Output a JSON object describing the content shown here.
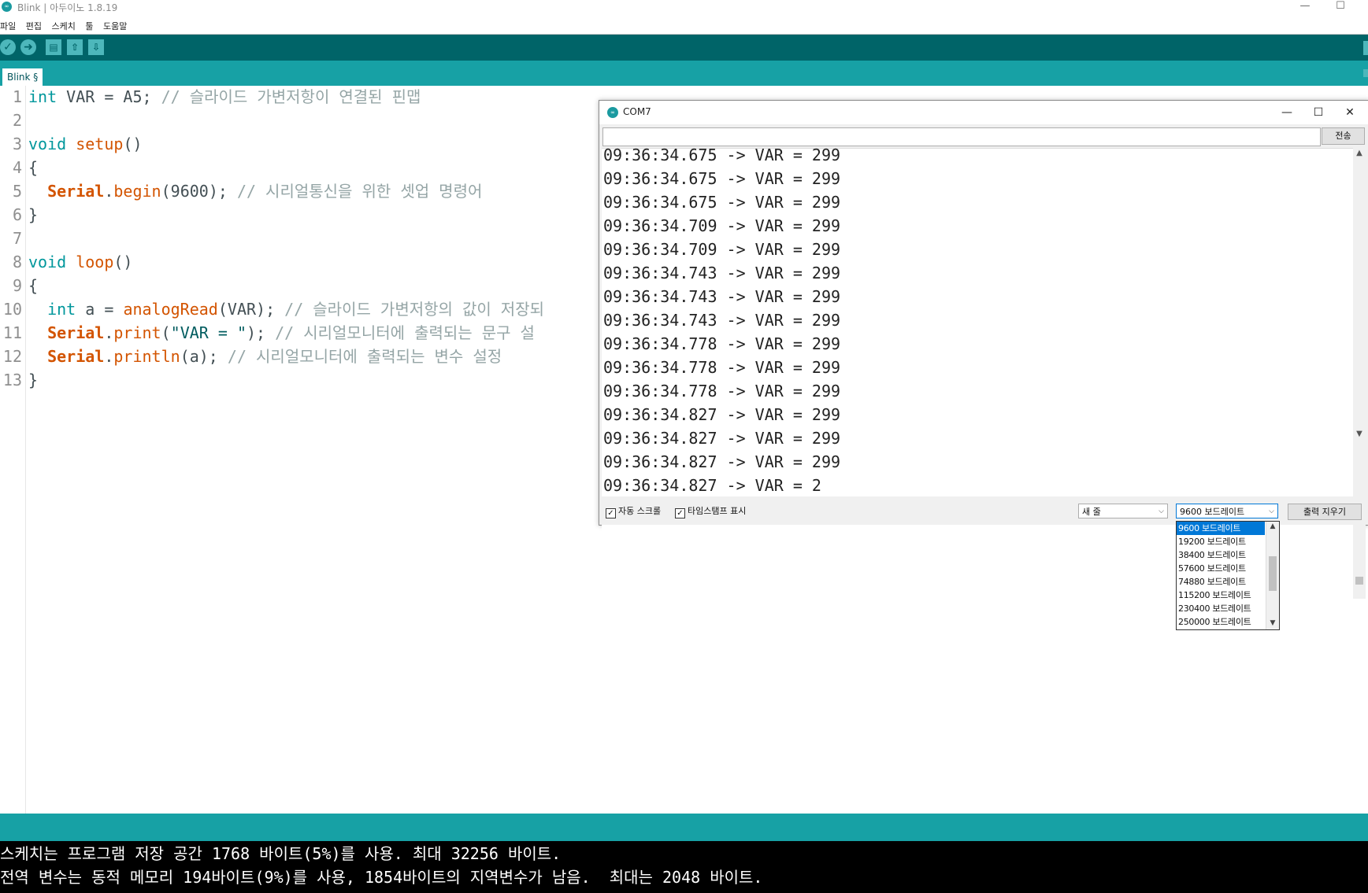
{
  "window": {
    "title": "Blink | 아두이노 1.8.19",
    "icon": "arduino-logo-icon",
    "min_glyph": "—",
    "max_glyph": "☐"
  },
  "menu": [
    "파일",
    "편집",
    "스케치",
    "툴",
    "도움말"
  ],
  "toolbar": {
    "verify_glyph": "✓",
    "upload_glyph": "➜",
    "new_glyph": "▤",
    "open_glyph": "⇧",
    "save_glyph": "⇩"
  },
  "tab": {
    "label": "Blink §"
  },
  "code": {
    "line_numbers": [
      "1",
      "2",
      "3",
      "4",
      "5",
      "6",
      "7",
      "8",
      "9",
      "10",
      "11",
      "12",
      "13"
    ],
    "l1": {
      "kw": "int",
      "rest": " VAR = A5; ",
      "comment": "// 슬라이드 가변저항이 연결된 핀맵"
    },
    "l3": {
      "kw": "void",
      "fn": "setup",
      "rest": "()"
    },
    "l4": "{",
    "l5": {
      "obj": "Serial",
      "dot": ".",
      "fn": "begin",
      "rest": "(9600); ",
      "comment": "// 시리얼통신을 위한 셋업 명령어"
    },
    "l6": "}",
    "l8": {
      "kw": "void",
      "fn": "loop",
      "rest": "()"
    },
    "l9": "{",
    "l10": {
      "kw": "int",
      "rest1": " a = ",
      "fn": "analogRead",
      "rest2": "(VAR); ",
      "comment": "// 슬라이드 가변저항의 값이 저장되"
    },
    "l11": {
      "obj": "Serial",
      "dot": ".",
      "fn": "print",
      "rest1": "(",
      "str": "\"VAR = \"",
      "rest2": "); ",
      "comment": "// 시리얼모니터에 출력되는 문구 설"
    },
    "l12": {
      "obj": "Serial",
      "dot": ".",
      "fn": "println",
      "rest": "(a); ",
      "comment": "// 시리얼모니터에 출력되는 변수 설정"
    },
    "l13": "}"
  },
  "console": {
    "line1": "스케치는 프로그램 저장 공간 1768 바이트(5%)를 사용. 최대 32256 바이트.",
    "line2": "전역 변수는 동적 메모리 194바이트(9%)를 사용, 1854바이트의 지역변수가 남음.  최대는 2048 바이트."
  },
  "serial_monitor": {
    "title": "COM7",
    "send_label": "전송",
    "input_value": "",
    "output_lines": [
      "09:36:34.675 -> VAR = 299",
      "09:36:34.675 -> VAR = 299",
      "09:36:34.675 -> VAR = 299",
      "09:36:34.709 -> VAR = 299",
      "09:36:34.709 -> VAR = 299",
      "09:36:34.743 -> VAR = 299",
      "09:36:34.743 -> VAR = 299",
      "09:36:34.743 -> VAR = 299",
      "09:36:34.778 -> VAR = 299",
      "09:36:34.778 -> VAR = 299",
      "09:36:34.778 -> VAR = 299",
      "09:36:34.827 -> VAR = 299",
      "09:36:34.827 -> VAR = 299",
      "09:36:34.827 -> VAR = 299",
      "09:36:34.827 -> VAR = 2"
    ],
    "autoscroll_label": "자동 스크롤",
    "autoscroll_checked": true,
    "timestamp_label": "타임스탬프 표시",
    "timestamp_checked": true,
    "line_ending_value": "새 줄",
    "baud_value": "9600 보드레이트",
    "clear_label": "출력 지우기",
    "baud_options": [
      "9600 보드레이트",
      "19200 보드레이트",
      "38400 보드레이트",
      "57600 보드레이트",
      "74880 보드레이트",
      "115200 보드레이트",
      "230400 보드레이트",
      "250000 보드레이트"
    ],
    "baud_selected_index": 0
  },
  "colors": {
    "toolbar": "#006468",
    "tabbar": "#17a1a5",
    "keyword": "#00979c",
    "function": "#d35400",
    "comment": "#95a5a6",
    "console_bg": "#000000",
    "selection": "#0078d7"
  }
}
